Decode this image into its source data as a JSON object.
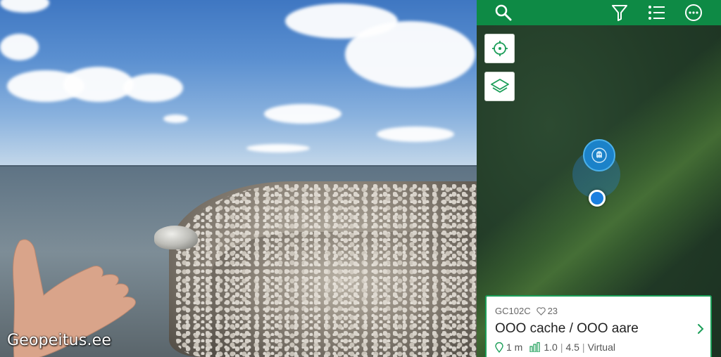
{
  "photo": {
    "watermark": "Geopeitus.ee"
  },
  "toolbar": {
    "search_icon": "search-icon",
    "filter_icon": "filter-icon",
    "list_icon": "list-icon",
    "more_icon": "more-icon",
    "color": "#0e8a45"
  },
  "map": {
    "locate_icon": "crosshair-icon",
    "layers_icon": "layers-icon"
  },
  "cache_card": {
    "code": "GC102C",
    "favorites": "23",
    "name": "OOO cache / OOO aare",
    "distance": "1 m",
    "difficulty": "1.0",
    "terrain": "4.5",
    "type": "Virtual",
    "sep": "|",
    "accent_color": "#1b9e58"
  }
}
